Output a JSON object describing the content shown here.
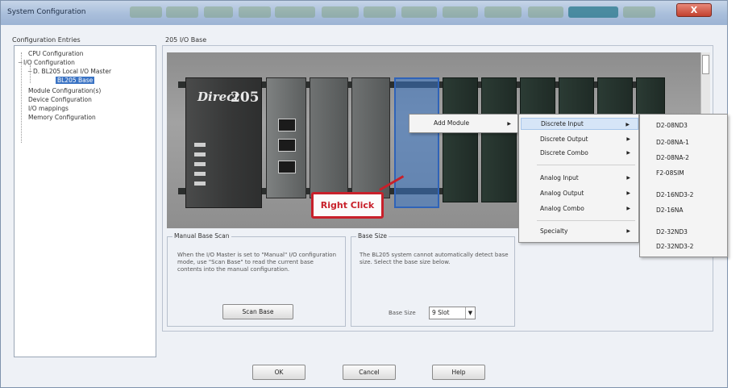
{
  "window": {
    "title": "System Configuration",
    "close_label": "X"
  },
  "tree": {
    "title": "Configuration Entries",
    "items": [
      {
        "label": "CPU Configuration",
        "expander": ""
      },
      {
        "label": "I/O Configuration",
        "expander": "−"
      },
      {
        "label": "D. BL205 Local I/O Master",
        "expander": "−"
      },
      {
        "label": "BL205 Base",
        "expander": ""
      },
      {
        "label": "Module Configuration(s)",
        "expander": ""
      },
      {
        "label": "Device Configuration",
        "expander": ""
      },
      {
        "label": "I/O mappings",
        "expander": ""
      },
      {
        "label": "Memory Configuration",
        "expander": ""
      }
    ]
  },
  "base_panel": {
    "title": "205 I/O Base"
  },
  "cpu_module": {
    "brand": "Direct",
    "model": "205"
  },
  "callout": {
    "label": "Right Click"
  },
  "manual_scan": {
    "title": "Manual Base Scan",
    "text": "When the I/O Master is set to \"Manual\" I/O configuration mode, use \"Scan Base\" to read the current base contents into the manual configuration.",
    "button": "Scan Base"
  },
  "base_size": {
    "title": "Base Size",
    "text": "The BL205 system cannot automatically detect base size. Select the base size below.",
    "label": "Base Size",
    "value": "9 Slot"
  },
  "context_menu": {
    "item": "Add Module"
  },
  "module_menu": {
    "items": [
      "Discrete Input",
      "Discrete Output",
      "Discrete Combo",
      "Analog Input",
      "Analog Output",
      "Analog Combo",
      "Specialty"
    ]
  },
  "input_menu": {
    "items": [
      "D2-08ND3",
      "D2-08NA-1",
      "D2-08NA-2",
      "F2-08SIM",
      "D2-16ND3-2",
      "D2-16NA",
      "D2-32ND3",
      "D2-32ND3-2"
    ]
  },
  "footer": {
    "ok": "OK",
    "cancel": "Cancel",
    "help": "Help"
  }
}
